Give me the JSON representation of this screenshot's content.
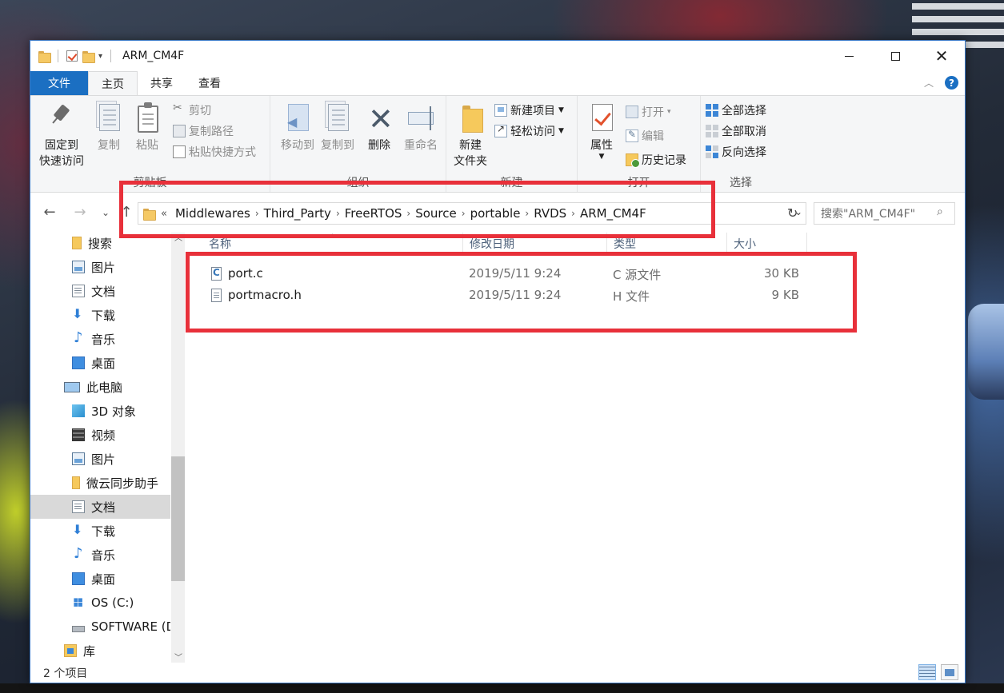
{
  "window": {
    "title": "ARM_CM4F",
    "controls": {
      "minimize": "minimize",
      "maximize": "maximize",
      "close": "close"
    }
  },
  "ribbon_tabs": {
    "file": "文件",
    "home": "主页",
    "share": "共享",
    "view": "查看",
    "active": "主页"
  },
  "ribbon": {
    "clipboard": {
      "label": "剪贴板",
      "pin_line1": "固定到",
      "pin_line2": "快速访问",
      "copy": "复制",
      "paste": "粘贴",
      "cut": "剪切",
      "copy_path": "复制路径",
      "paste_shortcut": "粘贴快捷方式"
    },
    "organize": {
      "label": "组织",
      "move_to": "移动到",
      "copy_to": "复制到",
      "delete": "删除",
      "rename": "重命名"
    },
    "new": {
      "label": "新建",
      "new_folder_line1": "新建",
      "new_folder_line2": "文件夹",
      "new_item": "新建项目",
      "easy_access": "轻松访问"
    },
    "open": {
      "label": "打开",
      "properties": "属性",
      "open": "打开",
      "edit": "编辑",
      "history": "历史记录"
    },
    "select": {
      "label": "选择",
      "select_all": "全部选择",
      "select_none": "全部取消",
      "invert": "反向选择"
    }
  },
  "address_bar": {
    "overflow": "«",
    "crumbs": [
      "Middlewares",
      "Third_Party",
      "FreeRTOS",
      "Source",
      "portable",
      "RVDS",
      "ARM_CM4F"
    ]
  },
  "search": {
    "placeholder": "搜索\"ARM_CM4F\""
  },
  "nav_pane": {
    "items": [
      {
        "label": "搜索",
        "icon": "search-folder-icon"
      },
      {
        "label": "图片",
        "icon": "pictures-icon"
      },
      {
        "label": "文档",
        "icon": "documents-icon"
      },
      {
        "label": "下载",
        "icon": "downloads-icon"
      },
      {
        "label": "音乐",
        "icon": "music-icon"
      },
      {
        "label": "桌面",
        "icon": "desktop-icon"
      },
      {
        "label": "此电脑",
        "icon": "this-pc-icon"
      },
      {
        "label": "3D 对象",
        "icon": "3d-objects-icon"
      },
      {
        "label": "视频",
        "icon": "videos-icon"
      },
      {
        "label": "图片",
        "icon": "pictures-icon"
      },
      {
        "label": "微云同步助手",
        "icon": "folder-icon"
      },
      {
        "label": "文档",
        "icon": "documents-icon"
      },
      {
        "label": "下载",
        "icon": "downloads-icon"
      },
      {
        "label": "音乐",
        "icon": "music-icon"
      },
      {
        "label": "桌面",
        "icon": "desktop-icon"
      },
      {
        "label": "OS (C:)",
        "icon": "os-drive-icon"
      },
      {
        "label": "SOFTWARE (D",
        "icon": "drive-icon"
      },
      {
        "label": "库",
        "icon": "library-icon"
      }
    ],
    "selected_index": 11
  },
  "columns": {
    "name": "名称",
    "modified": "修改日期",
    "type": "类型",
    "size": "大小"
  },
  "files": [
    {
      "name": "port.c",
      "modified": "2019/5/11 9:24",
      "type": "C 源文件",
      "size": "30 KB",
      "icon": "c-source-file-icon"
    },
    {
      "name": "portmacro.h",
      "modified": "2019/5/11 9:24",
      "type": "H 文件",
      "size": "9 KB",
      "icon": "header-file-icon"
    }
  ],
  "status": {
    "item_count": "2 个项目"
  },
  "colors": {
    "accent": "#1b6fc2",
    "annotation": "#e8303a",
    "selection": "#d9d9d9"
  }
}
